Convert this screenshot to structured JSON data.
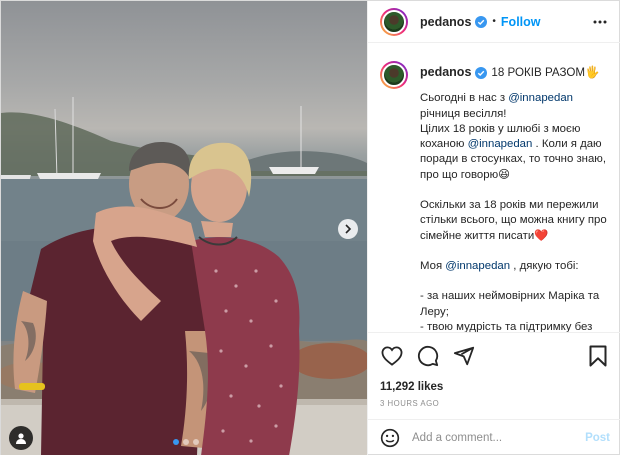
{
  "header": {
    "username": "pedanos",
    "separator": "•",
    "follow_label": "Follow"
  },
  "caption": {
    "username": "pedanos",
    "title": "18 РОКІВ РАЗОМ🖐",
    "p1_pre": "Сьогодні в нас з ",
    "p1_mention": "@innapedan",
    "p1_post": " річниця весілля!",
    "p2_pre": "Цілих 18 років у шлюбі з моєю коханою ",
    "p2_mention": "@innapedan",
    "p2_post": " . Коли я даю поради в стосунках, то точно знаю, про що говорю😆",
    "p3": "Оскільки за 18 років ми пережили стільки всього, що можна книгу про сімейне життя писати❤️",
    "p4_pre": "Моя ",
    "p4_mention": "@innapedan",
    "p4_post": " , дякую тобі:",
    "p5_line1": "- за наших неймовірних Маріка та Леру;",
    "p5_line2": "- твою мудрість та підтримку без якої не було б всього, що є зараз;"
  },
  "engagement": {
    "likes": "11,292 likes",
    "time": "3 HOURS AGO"
  },
  "comment": {
    "placeholder": "Add a comment...",
    "post_label": "Post"
  },
  "carousel": {
    "slide_count": 3,
    "active_index": 0
  },
  "icons": {
    "verified": "verified-badge-icon",
    "more": "more-options-icon",
    "like": "heart-icon",
    "comment": "comment-icon",
    "share": "paper-plane-icon",
    "save": "bookmark-icon",
    "emoji": "smiley-icon",
    "tags": "user-tag-icon",
    "next": "chevron-right-icon"
  },
  "colors": {
    "accent": "#0095f6",
    "verified": "#3897f0",
    "text": "#262626",
    "muted": "#8e8e8e",
    "post_disabled": "#b2dffc"
  }
}
